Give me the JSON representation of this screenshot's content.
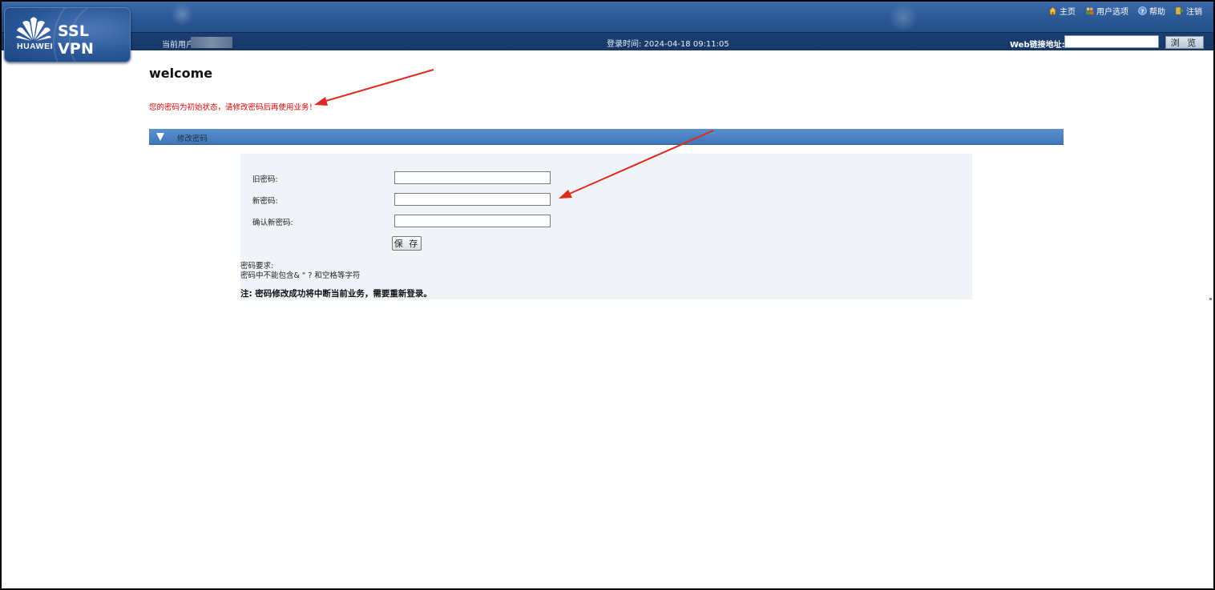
{
  "header": {
    "logo_title": "SSL VPN",
    "logo_brand": "HUAWEI",
    "links": [
      {
        "label": "主页",
        "icon": "home-icon"
      },
      {
        "label": "用户选项",
        "icon": "users-icon"
      },
      {
        "label": "帮助",
        "icon": "help-icon"
      },
      {
        "label": "注销",
        "icon": "logout-icon"
      }
    ],
    "current_user_label": "当前用户",
    "login_time": "登录时间: 2024-04-18  09:11:05",
    "web_link_label": "Web链接地址:",
    "web_link_value": "",
    "browse_label": "浏 览"
  },
  "main": {
    "welcome": "welcome",
    "warning": "您的密码为初始状态，请修改密码后再使用业务！",
    "section_title": "修改密码",
    "fields": [
      {
        "label": "旧密码:",
        "value": ""
      },
      {
        "label": "新密码:",
        "value": ""
      },
      {
        "label": "确认新密码:",
        "value": ""
      }
    ],
    "save_label": "保 存",
    "requirements_title": "密码要求:",
    "requirements_text": "密码中不能包含& \" ? 和空格等字符",
    "note": "注:  密码修改成功将中断当前业务，需要重新登录。"
  },
  "colors": {
    "header_blue": "#2a5794",
    "subbar_navy": "#163766",
    "section_blue": "#3e76b9",
    "warning_red": "#e00000",
    "annotation_arrow": "#e02a20"
  }
}
